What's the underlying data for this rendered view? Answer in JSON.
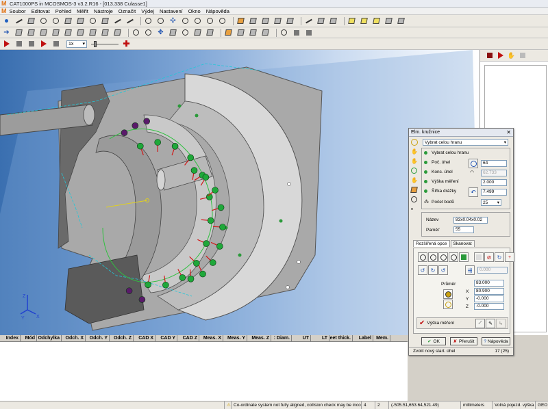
{
  "window": {
    "title": "CAT1000PS in MCOSMOS-3 v3.2.R16  -  [013.338 Culasse1]",
    "logo": "M"
  },
  "menu": {
    "items": [
      "Soubor",
      "Editovat",
      "Pohled",
      "Měřit",
      "Nástroje",
      "Označit",
      "Výdej",
      "Nastavení",
      "Okno",
      "Nápověda"
    ]
  },
  "playback": {
    "zoom": "1x"
  },
  "table": {
    "columns": [
      "Index",
      "Mód",
      "Odchylka",
      "Odch. X",
      "Odch. Y",
      "Odch. Z",
      "CAD X",
      "CAD Y",
      "CAD Z",
      "Meas. X",
      "Meas. Y",
      "Meas. Z",
      ": Diam.",
      "UT",
      "LT",
      "eet thick.",
      "Label",
      "Mem."
    ]
  },
  "dialog": {
    "title": "Elm. kružnice",
    "select_mode": "Vybrat celou hranu",
    "options": {
      "select_edge": "Vybrat celou hranu",
      "start_angle": {
        "label": "Poč. úhel",
        "value": "64"
      },
      "end_angle": {
        "label": "Konc. úhel",
        "value": "62.733"
      },
      "measure_height": {
        "label": "Výška měření",
        "value": "2.000"
      },
      "arc_width": {
        "label": "Šířka drážky",
        "value": "7.499"
      },
      "points_count": {
        "label": "Počet bodů",
        "value": "25"
      }
    },
    "name_label": "Název",
    "name_value": "83x0.04x0.02",
    "memory_label": "Paměť",
    "memory_value": "55",
    "tabs": [
      "Rozšířená opce",
      "Skanovat"
    ],
    "deviation_value": "0.000",
    "diameter_label": "Průměr",
    "diameter_value": "83.000",
    "x_label": "X",
    "x_value": "80.900",
    "y_label": "Y",
    "y_value": "-0.000",
    "z_label": "Z",
    "z_value": "-0.000",
    "height_label": "Výška měření",
    "ok_label": "OK",
    "cancel_label": "Přerušit",
    "help_label": "Nápověda",
    "status_text": "Zvolit nový start. úhel",
    "status_count": "17 (25)"
  },
  "axis": {
    "x": "X",
    "y": "Y",
    "z": "Z"
  },
  "status": {
    "message": "Co-ordinate system not fully aligned, collision check may be incorrect.",
    "probe": "4",
    "count": "2",
    "coords": "(-505.51,653.64,521.49)",
    "units": "millimeters",
    "mode": "Volná pojezd. výška zap.",
    "sys": "GEO"
  },
  "colors": {
    "viewport_left": "#3a6fb0",
    "viewport_right": "#ffffff",
    "point_green": "#1fa83a",
    "point_purple": "#5a1a6a",
    "vector_red": "#d01818"
  }
}
